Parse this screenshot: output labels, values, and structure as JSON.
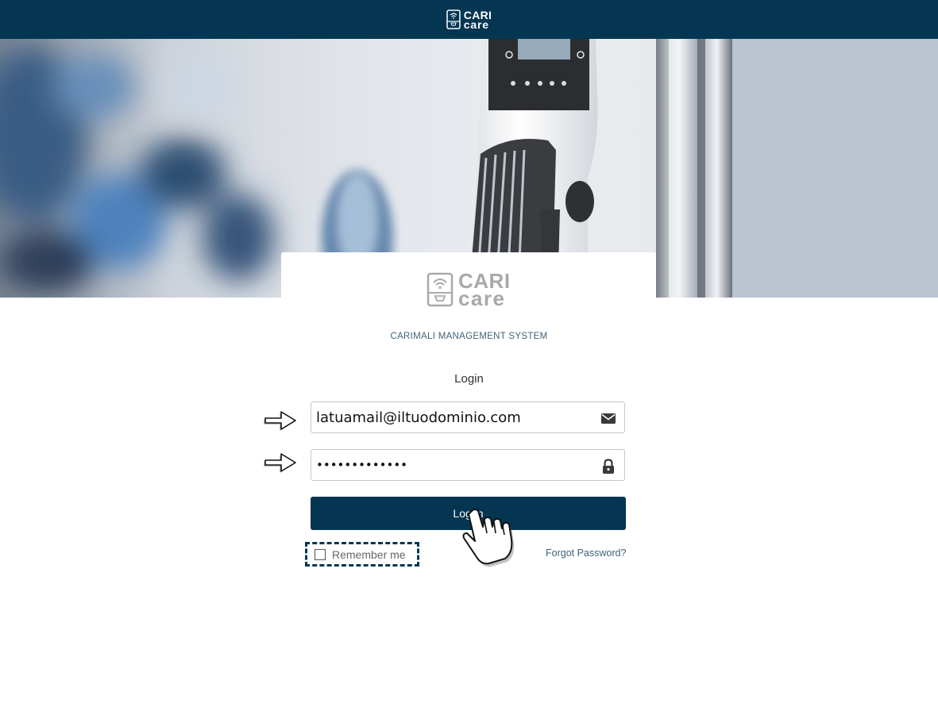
{
  "header": {
    "logo_line1": "CARI",
    "logo_line2": "care"
  },
  "card": {
    "logo_line1": "CARI",
    "logo_line2": "care",
    "subtitle": "CARIMALI MANAGEMENT SYSTEM",
    "title": "Login"
  },
  "form": {
    "email_value": "latuamail@iltuodominio.com",
    "email_icon": "envelope-icon",
    "password_value": "•••••••••••••",
    "password_icon": "lock-icon",
    "login_label": "Log in",
    "remember_label": "Remember me",
    "remember_checked": false,
    "forgot_label": "Forgot Password?"
  },
  "annotations": {
    "pointer_arrows": "arrow-right-icon",
    "cursor": "hand-pointer-icon",
    "highlight_color": "#043652"
  },
  "colors": {
    "primary": "#043652",
    "link": "#3d6278"
  }
}
